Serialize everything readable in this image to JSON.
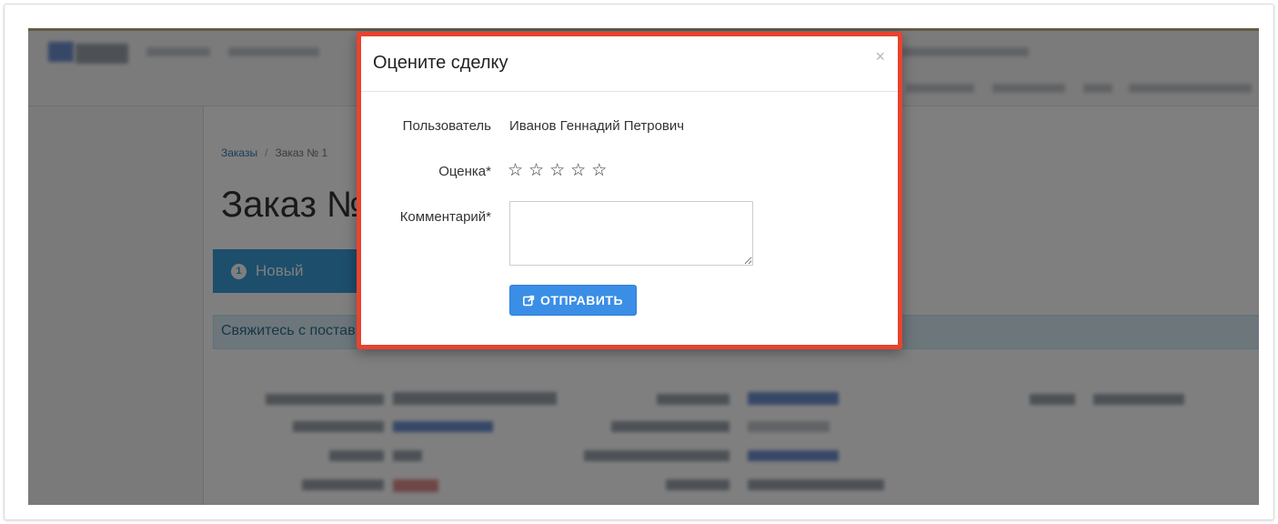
{
  "background": {
    "breadcrumb": {
      "link": "Заказы",
      "separator": "/",
      "current": "Заказ № 1"
    },
    "page_title": "Заказ №",
    "step": {
      "number": "1",
      "label": "Новый"
    },
    "contact_panel_text": "Свяжитесь с постав"
  },
  "modal": {
    "title": "Оцените сделку",
    "close_glyph": "×",
    "fields": {
      "user_label": "Пользователь",
      "user_value": "Иванов Геннадий Петрович",
      "rating_label": "Оценка*",
      "rating_value": 0,
      "rating_max": 5,
      "comment_label": "Комментарий*",
      "comment_value": ""
    },
    "submit_label": "ОТПРАВИТЬ",
    "submit_icon": "share-square-icon"
  },
  "colors": {
    "highlight_border": "#e8432f",
    "primary_button": "#3a8ee6",
    "step_blue": "#3a9cd8",
    "info_panel": "#d9edf7"
  }
}
